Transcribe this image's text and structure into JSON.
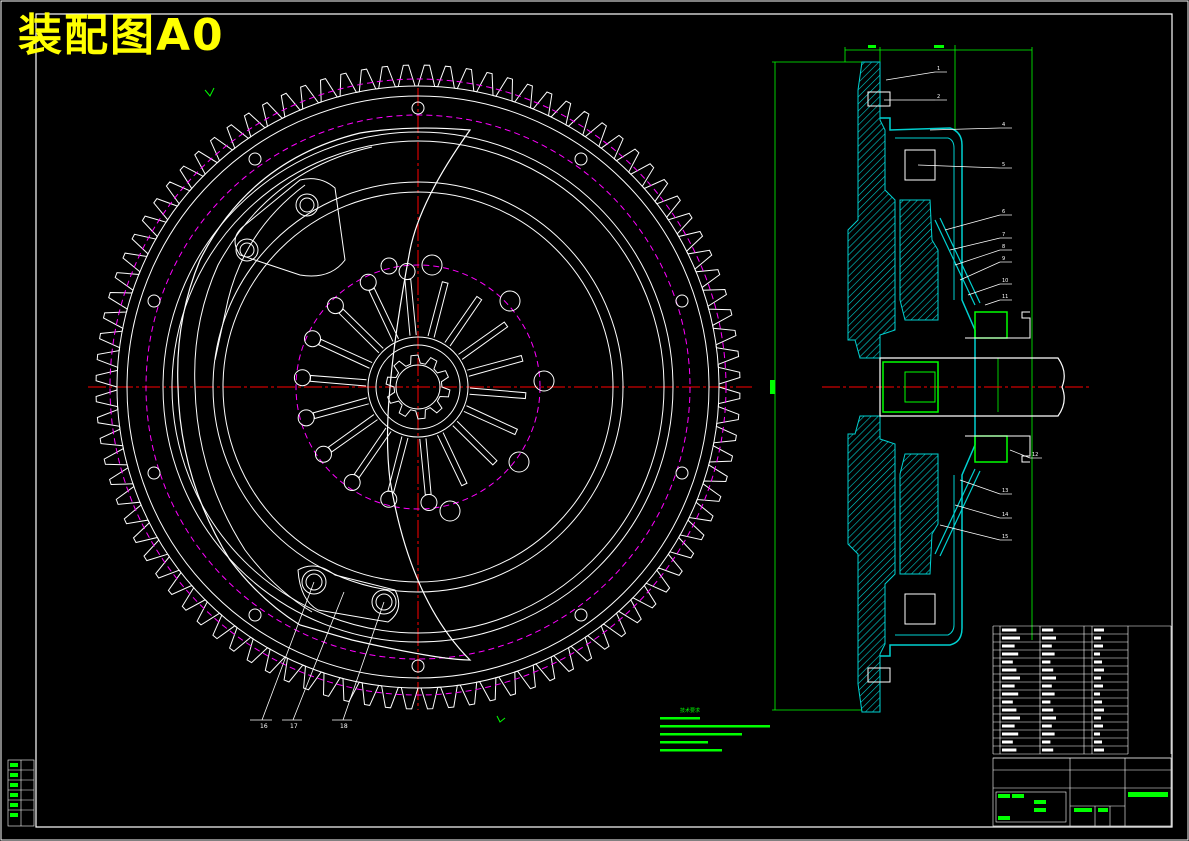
{
  "title": "装配图A0",
  "colors": {
    "background": "#000000",
    "outline": "#ffffff",
    "centerline": "#ff0000",
    "phantom": "#ff00ff",
    "section": "#00d0d0",
    "dimension": "#00ff00",
    "title": "#ffff00"
  },
  "front_view": {
    "tooth_count": 96
  },
  "callouts_front": [
    "16",
    "17",
    "18"
  ],
  "callouts_side": [
    "1",
    "2",
    "4",
    "5",
    "6",
    "7",
    "8",
    "9",
    "10",
    "11",
    "12",
    "13",
    "14",
    "15"
  ],
  "notes": {
    "heading": "技术要求"
  }
}
